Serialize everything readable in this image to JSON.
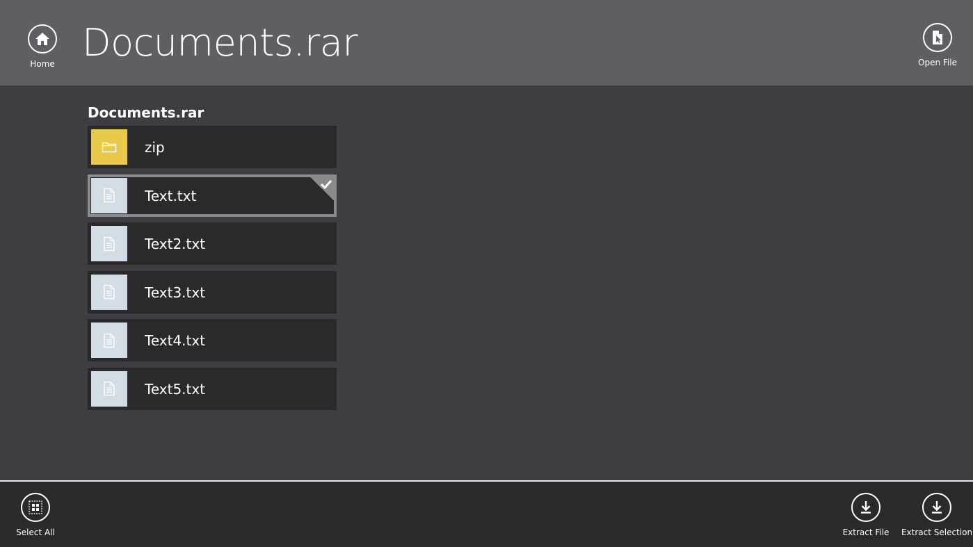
{
  "header": {
    "title": "Documents.rar",
    "home_label": "Home",
    "open_file_label": "Open File"
  },
  "content": {
    "section_title": "Documents.rar",
    "items": [
      {
        "name": "zip",
        "type": "folder",
        "icon": "folder-icon",
        "thumb_color": "#e8c94a",
        "selected": false
      },
      {
        "name": "Text.txt",
        "type": "file",
        "icon": "document-icon",
        "thumb_color": "#d3dde6",
        "selected": true
      },
      {
        "name": "Text2.txt",
        "type": "file",
        "icon": "document-icon",
        "thumb_color": "#d3dde6",
        "selected": false
      },
      {
        "name": "Text3.txt",
        "type": "file",
        "icon": "document-icon",
        "thumb_color": "#d3dde6",
        "selected": false
      },
      {
        "name": "Text4.txt",
        "type": "file",
        "icon": "document-icon",
        "thumb_color": "#d3dde6",
        "selected": false
      },
      {
        "name": "Text5.txt",
        "type": "file",
        "icon": "document-icon",
        "thumb_color": "#d3dde6",
        "selected": false
      }
    ]
  },
  "appbar": {
    "select_all_label": "Select All",
    "extract_file_label": "Extract File",
    "extract_selection_label": "Extract Selection"
  },
  "colors": {
    "header_bg": "#5f5e64",
    "content_bg": "#3e3d42",
    "appbar_bg": "#2a2a2c",
    "item_bg": "#2a2a2c",
    "selection_accent": "#8a8a8c"
  }
}
